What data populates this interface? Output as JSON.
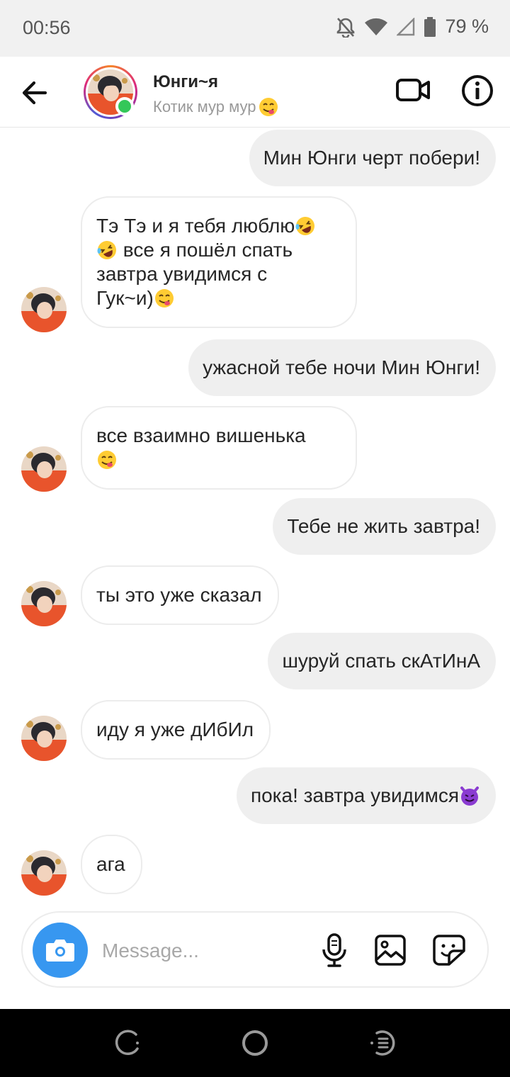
{
  "status_bar": {
    "time": "00:56",
    "battery": "79 %"
  },
  "header": {
    "name": "Юнги~я",
    "subtitle": "Котик мур мур",
    "subtitle_emoji": "yum-face-icon"
  },
  "messages": [
    {
      "dir": "out",
      "text": "Мин Юнги черт побери!"
    },
    {
      "dir": "in",
      "lines": [
        "Тэ Тэ и я тебя люблю",
        " все я пошёл спать",
        "завтра увидимся с",
        "Гук~и)"
      ]
    },
    {
      "dir": "out",
      "text": "ужасной тебе ночи Мин Юнги!"
    },
    {
      "dir": "in",
      "text": "все взаимно вишенька"
    },
    {
      "dir": "out",
      "text": "Тебе не жить завтра!"
    },
    {
      "dir": "in",
      "text": "ты это уже сказал"
    },
    {
      "dir": "out",
      "text": "шуруй спать скАтИнА"
    },
    {
      "dir": "in",
      "text": "иду я уже дИбИл"
    },
    {
      "dir": "out",
      "text": "пока! завтра увидимся"
    },
    {
      "dir": "in",
      "text": "ага"
    }
  ],
  "composer": {
    "placeholder": "Message..."
  },
  "colors": {
    "accent": "#3797f0",
    "online": "#34c759",
    "bubble_out": "#efefef"
  }
}
